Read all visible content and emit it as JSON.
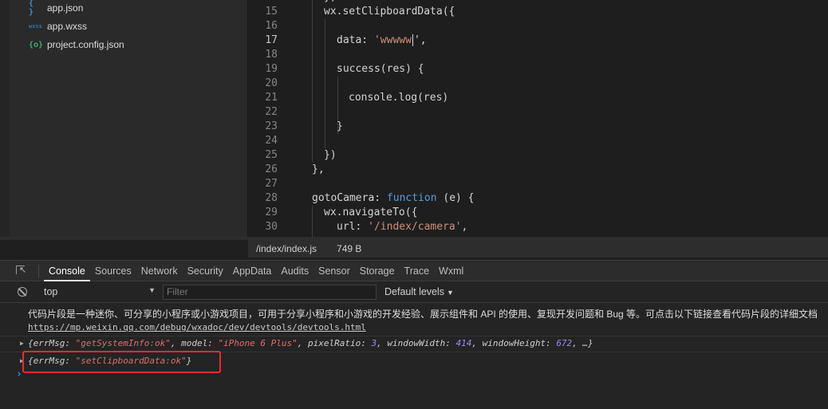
{
  "explorer": {
    "files": [
      {
        "icon": "{ }",
        "name": "app.json"
      },
      {
        "icon": "wxss",
        "name": "app.wxss"
      },
      {
        "icon": "{o}",
        "name": "project.config.json"
      }
    ]
  },
  "editor": {
    "line_numbers": [
      "15",
      "16",
      "17",
      "18",
      "19",
      "20",
      "21",
      "22",
      "23",
      "24",
      "25",
      "26",
      "27",
      "28",
      "29",
      "30"
    ],
    "active_line": "17",
    "code": {
      "l15": "wx.setClipboardData({",
      "l17_a": "data: ",
      "l17_str": "'wwwww",
      "l17_end": "',",
      "l19": "success(res) {",
      "l21": "console.log(res)",
      "l23": "}",
      "l25": "})",
      "l26": "},",
      "l28_a": "gotoCamera: ",
      "l28_kw": "function",
      "l28_b": " (e) {",
      "l29": "wx.navigateTo({",
      "l30_a": "url: ",
      "l30_str": "'/index/camera'",
      "l30_b": ","
    }
  },
  "status": {
    "path": "/index/index.js",
    "size": "749 B"
  },
  "devtools": {
    "tabs": [
      "Console",
      "Sources",
      "Network",
      "Security",
      "AppData",
      "Audits",
      "Sensor",
      "Storage",
      "Trace",
      "Wxml"
    ],
    "active_tab": "Console",
    "context": "top",
    "filter_placeholder": "Filter",
    "levels": "Default levels"
  },
  "console": {
    "info": "代码片段是一种迷你、可分享的小程序或小游戏项目，可用于分享小程序和小游戏的开发经验、展示组件和 API 的使用、复现开发问题和 Bug 等。可点击以下链接查看代码片段的详细文档",
    "link": "https://mp.weixin.qq.com/debug/wxadoc/dev/devtools/devtools.html",
    "obj1": {
      "p1": "{errMsg: ",
      "v1": "\"getSystemInfo:ok\"",
      "p2": ", model: ",
      "v2": "\"iPhone 6 Plus\"",
      "p3": ", pixelRatio: ",
      "v3": "3",
      "p4": ", windowWidth: ",
      "v4": "414",
      "p5": ", windowHeight: ",
      "v5": "672",
      "p6": ", …}"
    },
    "obj2": {
      "p1": "{errMsg: ",
      "v1": "\"setClipboardData:ok\"",
      "p2": "}"
    },
    "prompt": "›"
  }
}
